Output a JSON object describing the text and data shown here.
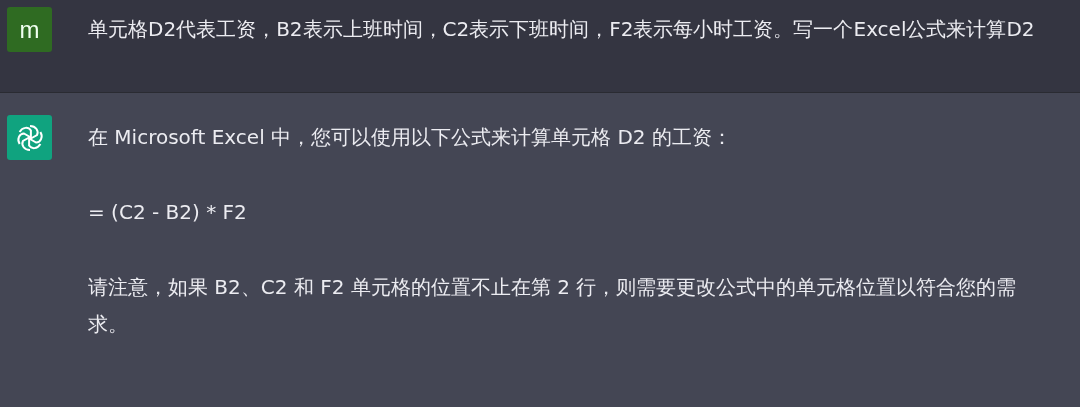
{
  "messages": [
    {
      "kind": "user",
      "avatar": "m",
      "paragraphs": [
        "单元格D2代表工资，B2表示上班时间，C2表示下班时间，F2表示每小时工资。写一个Excel公式来计算D2"
      ]
    },
    {
      "kind": "assistant",
      "paragraphs": [
        "在 Microsoft Excel 中，您可以使用以下公式来计算单元格 D2 的工资：",
        "= (C2 - B2) * F2",
        "请注意，如果 B2、C2 和 F2 单元格的位置不止在第 2 行，则需要更改公式中的单元格位置以符合您的需求。"
      ]
    }
  ]
}
